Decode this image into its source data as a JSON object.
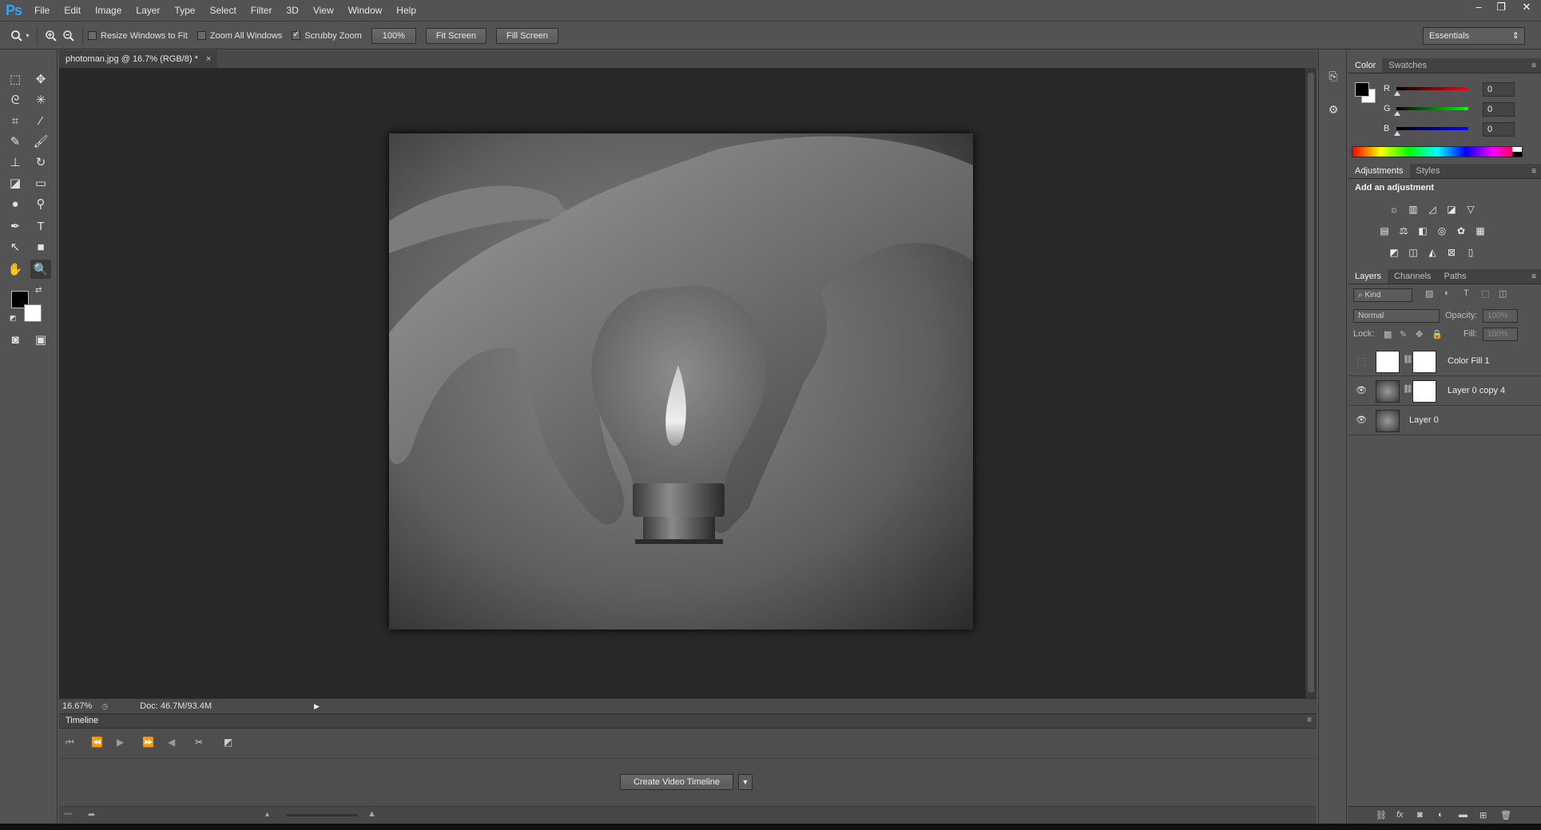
{
  "app": {
    "logo": "Ps"
  },
  "menu": [
    "File",
    "Edit",
    "Image",
    "Layer",
    "Type",
    "Select",
    "Filter",
    "3D",
    "View",
    "Window",
    "Help"
  ],
  "window_controls": {
    "minimize": "–",
    "restore": "❐",
    "close": "✕"
  },
  "options": {
    "resize_windows": "Resize Windows to Fit",
    "zoom_all": "Zoom All Windows",
    "scrubby_zoom": "Scrubby Zoom",
    "zoom_value": "100%",
    "fit_screen": "Fit Screen",
    "fill_screen": "Fill Screen",
    "workspace": "Essentials",
    "resize_checked": false,
    "zoom_all_checked": false,
    "scrubby_checked": true
  },
  "document": {
    "tab_title": "photoman.jpg @ 16.7% (RGB/8) *",
    "close": "×"
  },
  "status": {
    "zoom": "16.67%",
    "doc": "Doc: 46.7M/93.4M"
  },
  "timeline": {
    "title": "Timeline",
    "create_button": "Create Video Timeline",
    "dropdown": "▼"
  },
  "color_panel": {
    "tabs": [
      "Color",
      "Swatches"
    ],
    "channels": [
      {
        "label": "R",
        "value": "0",
        "color": "#e02020"
      },
      {
        "label": "G",
        "value": "0",
        "color": "#20c020"
      },
      {
        "label": "B",
        "value": "0",
        "color": "#2040e0"
      }
    ]
  },
  "adjustments_panel": {
    "tabs": [
      "Adjustments",
      "Styles"
    ],
    "heading": "Add an adjustment"
  },
  "layers_panel": {
    "tabs": [
      "Layers",
      "Channels",
      "Paths"
    ],
    "filter_kind": "Kind",
    "blend_mode": "Normal",
    "opacity_label": "Opacity:",
    "opacity_value": "100%",
    "lock_label": "Lock:",
    "fill_label": "Fill:",
    "fill_value": "100%",
    "layers": [
      {
        "name": "Color Fill 1",
        "visible": false
      },
      {
        "name": "Layer 0 copy 4",
        "visible": true
      },
      {
        "name": "Layer 0",
        "visible": true
      }
    ]
  }
}
